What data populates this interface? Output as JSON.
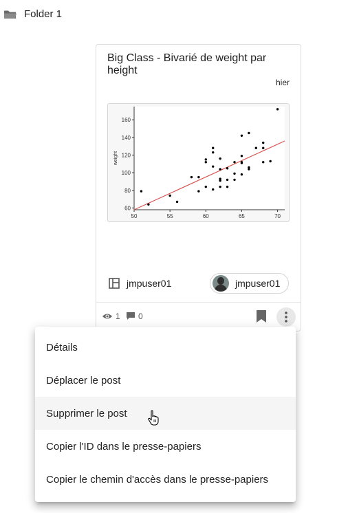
{
  "folder": {
    "icon": "folder-icon",
    "label": "Folder 1"
  },
  "card": {
    "title": "Big Class - Bivarié de weight par height",
    "date": "hier",
    "owner": {
      "icon": "dashboard-layout-icon",
      "name": "jmpuser01"
    },
    "author": {
      "name": "jmpuser01"
    },
    "views": "1",
    "comments": "0"
  },
  "chart_data": {
    "type": "scatter",
    "title": "",
    "xlabel": "",
    "ylabel": "weight",
    "xlim": [
      50,
      71
    ],
    "ylim": [
      58,
      175
    ],
    "xticks": [
      "50",
      "55",
      "60",
      "65",
      "70"
    ],
    "yticks": [
      "60",
      "80",
      "100",
      "120",
      "140",
      "160"
    ],
    "grid": false,
    "fit_line": {
      "color": "#d9534f",
      "from": [
        50,
        58
      ],
      "to": [
        71,
        136
      ]
    },
    "points": [
      [
        51,
        79
      ],
      [
        52,
        64
      ],
      [
        55,
        74
      ],
      [
        56,
        67
      ],
      [
        58,
        95
      ],
      [
        59,
        79
      ],
      [
        59,
        95
      ],
      [
        60,
        84
      ],
      [
        60,
        112
      ],
      [
        60,
        115
      ],
      [
        61,
        81
      ],
      [
        61,
        107
      ],
      [
        61,
        123
      ],
      [
        61,
        128
      ],
      [
        62,
        84
      ],
      [
        62,
        91
      ],
      [
        62,
        93
      ],
      [
        62,
        104
      ],
      [
        62,
        116
      ],
      [
        63,
        84
      ],
      [
        63,
        92
      ],
      [
        63,
        105
      ],
      [
        64,
        92
      ],
      [
        64,
        99
      ],
      [
        64,
        112
      ],
      [
        65,
        98
      ],
      [
        65,
        111
      ],
      [
        65,
        112
      ],
      [
        65,
        119
      ],
      [
        65,
        142
      ],
      [
        66,
        104
      ],
      [
        66,
        106
      ],
      [
        66,
        145
      ],
      [
        67,
        128
      ],
      [
        68,
        112
      ],
      [
        68,
        128
      ],
      [
        68,
        134
      ],
      [
        69,
        113
      ],
      [
        70,
        172
      ]
    ]
  },
  "menu": {
    "items": [
      "Détails",
      "Déplacer le post",
      "Supprimer le post",
      "Copier l'ID dans le presse-papiers",
      "Copier le chemin d'accès dans le presse-papiers"
    ],
    "hovered_index": 2
  }
}
